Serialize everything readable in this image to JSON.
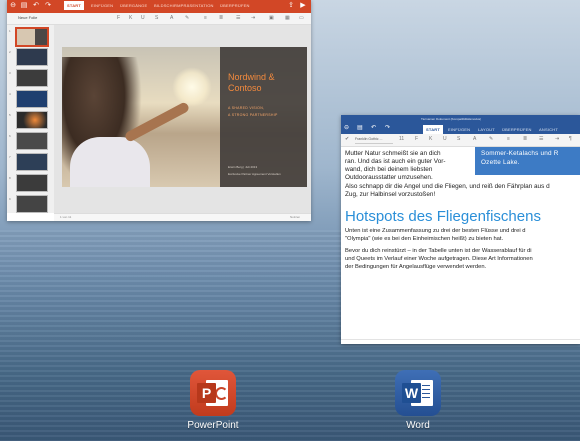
{
  "powerpoint": {
    "title_tabs": [
      "START",
      "EINFÜGEN",
      "ÜBERGÄNGE",
      "BILDSCHIRMPRÄSENTATION",
      "ÜBERPRÜFEN"
    ],
    "new_slide_label": "Neue Folie",
    "thumb_numbers": [
      "1",
      "2",
      "3",
      "4",
      "5",
      "6",
      "7",
      "8",
      "9",
      "10"
    ],
    "slide": {
      "title_line1": "Nordwind &",
      "title_line2": "Contoso",
      "subtitle_line1": "A SHARED VISION,",
      "subtitle_line2": "A STRONG PARTNERSHIP",
      "footer_line1": "Erwin Berg | Juli 2013",
      "footer_line2": "Exclusive Partner Agreement Vorstellen"
    },
    "status_left": "1 von 11",
    "status_right": "Notizen"
  },
  "word": {
    "window_title": "Tiernamen Dokument (Kompatibilitätsmodus)",
    "tabs": [
      "START",
      "EINFÜGEN",
      "LAYOUT",
      "ÜBERPRÜFEN",
      "ANSICHT"
    ],
    "font_name": "Franklin Gothic ...",
    "body": {
      "line1": "Mutter Natur schmeißt sie an dich",
      "line2": "ran. Und das ist auch ein guter Vor-",
      "line3": "wand, dich bei deinem liebsten",
      "line4": "Outdoorausstatter umzusehen.",
      "line5": "Also schnapp dir die Angel und die Fliegen, und reiß den Fährplan aus d",
      "line6": "Zug, zur Halbinsel vorzustoßen!",
      "heading": "Hotspots des Fliegenfischens",
      "para2_line1": "Unten ist eine Zusammenfassung zu drei der besten Flüsse und drei d",
      "para2_line2": "\"Olympia\" (wie es bei den Einheimischen heißt) zu bieten hat.",
      "para3_line1": "Bevor du dich reinstürzt – in der Tabelle unten ist der Wasserablauf für di",
      "para3_line2": "und Queets im Verlauf einer Woche aufgetragen. Diese Art Informationen",
      "para3_line3": "der Bedingungen für Angelausflüge verwendet werden."
    },
    "sidebar_box": {
      "line1": "Sommer-Ketalachs und R",
      "line2": "Ozette Lake."
    }
  },
  "dock": {
    "powerpoint_label": "PowerPoint",
    "powerpoint_icon_letter": "P",
    "word_label": "Word",
    "word_icon_letter": "W"
  },
  "colors": {
    "powerpoint_accent": "#d24726",
    "word_accent": "#2b579a",
    "heading_blue": "#2b8fd8",
    "slide_title_orange": "#f28a3e"
  }
}
